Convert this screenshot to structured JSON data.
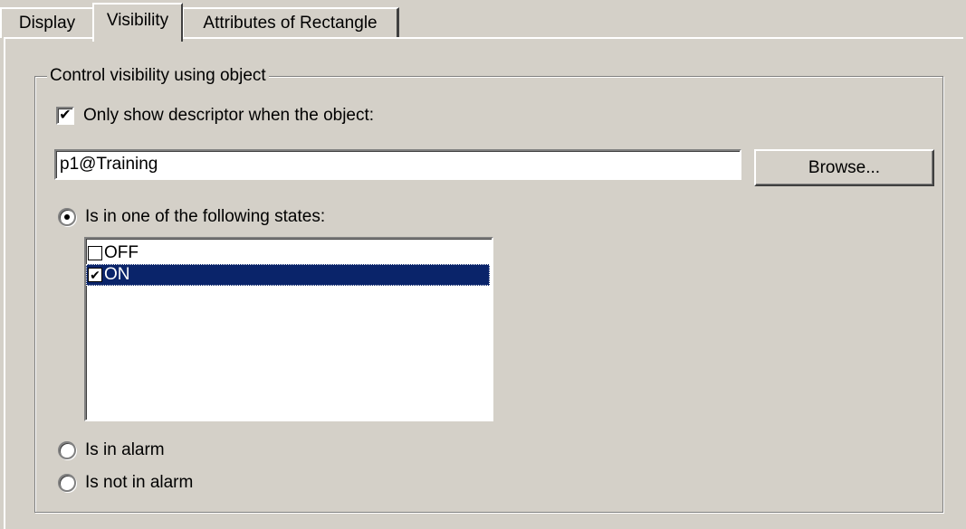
{
  "tabs": [
    {
      "label": "Display",
      "active": false
    },
    {
      "label": "Visibility",
      "active": true
    },
    {
      "label": "Attributes of Rectangle",
      "active": false
    }
  ],
  "group": {
    "title": "Control visibility using object"
  },
  "only_show_checkbox": {
    "label": "Only show descriptor when the object:",
    "checked": true
  },
  "object_field": {
    "value": "p1@Training"
  },
  "browse_button": {
    "label": "Browse..."
  },
  "state_radio": {
    "label": "Is in one of the following states:",
    "selected": true
  },
  "states_list": {
    "items": [
      {
        "label": "OFF",
        "checked": false,
        "selected": false
      },
      {
        "label": "ON",
        "checked": true,
        "selected": true
      }
    ]
  },
  "alarm_radio": {
    "label": "Is in alarm",
    "selected": false
  },
  "not_alarm_radio": {
    "label": "Is not in alarm",
    "selected": false
  },
  "icons": {
    "checkmark": "✔"
  },
  "colors": {
    "window_bg": "#d4d0c8",
    "selection_bg": "#0a246a",
    "selection_fg": "#ffffff"
  }
}
